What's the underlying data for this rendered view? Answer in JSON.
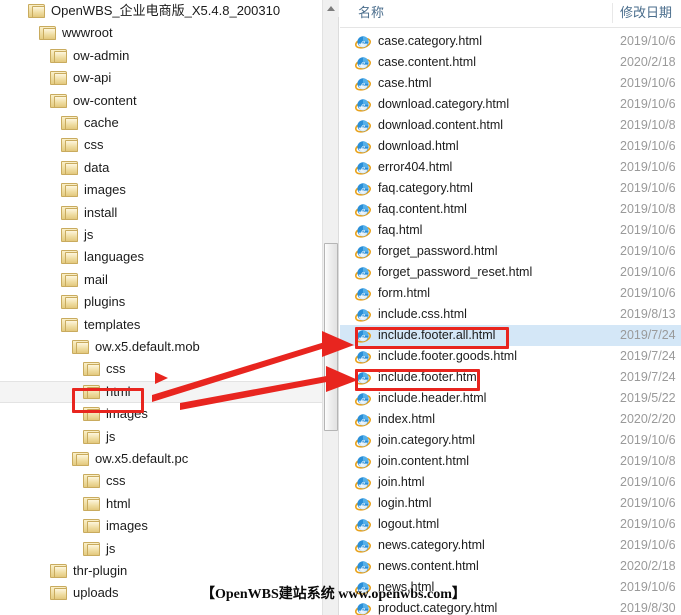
{
  "window": {
    "kind": "file-explorer",
    "accent_selection": "#d4e7f7",
    "annotation_color": "#e8251f"
  },
  "tree": {
    "scrollbar": {
      "up_arrow": "scroll-up-arrow"
    },
    "items": [
      {
        "label": "OpenWBS_企业电商版_X5.4.8_200310",
        "depth": 0
      },
      {
        "label": "wwwroot",
        "depth": 1
      },
      {
        "label": "ow-admin",
        "depth": 2
      },
      {
        "label": "ow-api",
        "depth": 2
      },
      {
        "label": "ow-content",
        "depth": 2
      },
      {
        "label": "cache",
        "depth": 3
      },
      {
        "label": "css",
        "depth": 3
      },
      {
        "label": "data",
        "depth": 3
      },
      {
        "label": "images",
        "depth": 3
      },
      {
        "label": "install",
        "depth": 3
      },
      {
        "label": "js",
        "depth": 3
      },
      {
        "label": "languages",
        "depth": 3
      },
      {
        "label": "mail",
        "depth": 3
      },
      {
        "label": "plugins",
        "depth": 3
      },
      {
        "label": "templates",
        "depth": 3
      },
      {
        "label": "ow.x5.default.mob",
        "depth": 4
      },
      {
        "label": "css",
        "depth": 5
      },
      {
        "label": "html",
        "depth": 5,
        "highlighted": true,
        "band": true
      },
      {
        "label": "images",
        "depth": 5
      },
      {
        "label": "js",
        "depth": 5
      },
      {
        "label": "ow.x5.default.pc",
        "depth": 4
      },
      {
        "label": "css",
        "depth": 5
      },
      {
        "label": "html",
        "depth": 5
      },
      {
        "label": "images",
        "depth": 5
      },
      {
        "label": "js",
        "depth": 5
      },
      {
        "label": "thr-plugin",
        "depth": 2
      },
      {
        "label": "uploads",
        "depth": 2
      }
    ]
  },
  "file_list": {
    "columns": {
      "name": "名称",
      "date": "修改日期"
    },
    "rows": [
      {
        "name": "case.category.html",
        "date": "2019/10/6"
      },
      {
        "name": "case.content.html",
        "date": "2020/2/18"
      },
      {
        "name": "case.html",
        "date": "2019/10/6"
      },
      {
        "name": "download.category.html",
        "date": "2019/10/6"
      },
      {
        "name": "download.content.html",
        "date": "2019/10/8"
      },
      {
        "name": "download.html",
        "date": "2019/10/6"
      },
      {
        "name": "error404.html",
        "date": "2019/10/6"
      },
      {
        "name": "faq.category.html",
        "date": "2019/10/6"
      },
      {
        "name": "faq.content.html",
        "date": "2019/10/8"
      },
      {
        "name": "faq.html",
        "date": "2019/10/6"
      },
      {
        "name": "forget_password.html",
        "date": "2019/10/6"
      },
      {
        "name": "forget_password_reset.html",
        "date": "2019/10/6"
      },
      {
        "name": "form.html",
        "date": "2019/10/6"
      },
      {
        "name": "include.css.html",
        "date": "2019/8/13"
      },
      {
        "name": "include.footer.all.html",
        "date": "2019/7/24",
        "selected": true,
        "highlighted": true
      },
      {
        "name": "include.footer.goods.html",
        "date": "2019/7/24"
      },
      {
        "name": "include.footer.html",
        "date": "2019/7/24",
        "highlighted": true
      },
      {
        "name": "include.header.html",
        "date": "2019/5/22"
      },
      {
        "name": "index.html",
        "date": "2020/2/20"
      },
      {
        "name": "join.category.html",
        "date": "2019/10/6"
      },
      {
        "name": "join.content.html",
        "date": "2019/10/8"
      },
      {
        "name": "join.html",
        "date": "2019/10/6"
      },
      {
        "name": "login.html",
        "date": "2019/10/6"
      },
      {
        "name": "logout.html",
        "date": "2019/10/6"
      },
      {
        "name": "news.category.html",
        "date": "2019/10/6"
      },
      {
        "name": "news.content.html",
        "date": "2020/2/18"
      },
      {
        "name": "news.html",
        "date": "2019/10/6"
      },
      {
        "name": "product.category.html",
        "date": "2019/8/30"
      }
    ]
  },
  "watermark": {
    "text": "【OpenWBS建站系统 www.openwbs.com】"
  }
}
